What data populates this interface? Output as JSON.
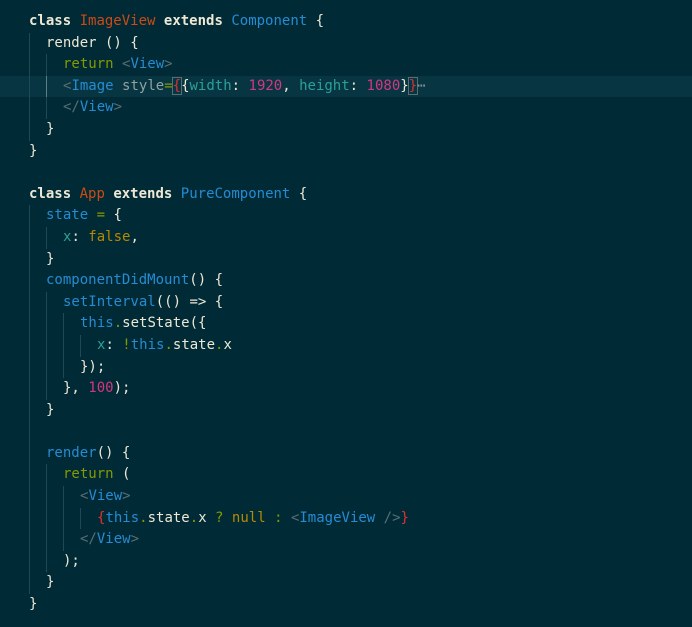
{
  "editor": {
    "theme": "solarized-dark",
    "background": "#002b36",
    "current_line_background": "#073642",
    "fold_icon": "chevron-right-icon",
    "folded_placeholder": "⋯"
  },
  "code": {
    "l1": {
      "kw_class": "class",
      "name": "ImageView",
      "kw_extends": "extends",
      "base": "Component",
      "open": " {"
    },
    "l2": {
      "method": "render",
      "rest": " () {"
    },
    "l3": {
      "kw_return": "return",
      "tag_open": "<",
      "tag": "View",
      "tag_close": ">"
    },
    "l4": {
      "tag_open": "<",
      "tag": "Image",
      "attr": "style",
      "eq": "=",
      "lbrace": "{",
      "obj_open": "{",
      "k1": "width",
      "c1": ": ",
      "v1": "1920",
      "sep": ", ",
      "k2": "height",
      "c2": ": ",
      "v2": "1080",
      "obj_close": "}",
      "rbrace": "}"
    },
    "l5": {
      "tag_open": "</",
      "tag": "View",
      "tag_close": ">"
    },
    "l6": {
      "text": "}"
    },
    "l7": {
      "text": "}"
    },
    "l9": {
      "kw_class": "class",
      "name": "App",
      "kw_extends": "extends",
      "base": "PureComponent",
      "open": " {"
    },
    "l10": {
      "name": "state",
      "eq": " =",
      "open": " {"
    },
    "l11": {
      "key": "x",
      "colon": ": ",
      "value": "false",
      "comma": ","
    },
    "l12": {
      "text": "}"
    },
    "l13": {
      "name": "componentDidMount",
      "rest": "() {"
    },
    "l14": {
      "fn": "setInterval",
      "rest": "(() ",
      "arrow": "=>",
      "open": " {"
    },
    "l15": {
      "kw_this": "this",
      "dot": ".",
      "method": "setState",
      "rest": "({"
    },
    "l16": {
      "key": "x",
      "colon": ": ",
      "bang": "!",
      "kw_this": "this",
      "dot1": ".",
      "p1": "state",
      "dot2": ".",
      "p2": "x"
    },
    "l17": {
      "text": "});"
    },
    "l18": {
      "pre": "}, ",
      "num": "100",
      "post": ");"
    },
    "l19": {
      "text": "}"
    },
    "l21": {
      "name": "render",
      "rest": "() {"
    },
    "l22": {
      "kw_return": "return",
      "rest": " ("
    },
    "l23": {
      "tag_open": "<",
      "tag": "View",
      "tag_close": ">"
    },
    "l24": {
      "lbrace": "{",
      "kw_this": "this",
      "dot1": ".",
      "p1": "state",
      "dot2": ".",
      "p2": "x",
      "q": " ? ",
      "null": "null",
      "colon": " : ",
      "tag_open": "<",
      "tag": "ImageView",
      "tag_close": " />",
      "rbrace": "}"
    },
    "l25": {
      "tag_open": "</",
      "tag": "View",
      "tag_close": ">"
    },
    "l26": {
      "text": ");"
    },
    "l27": {
      "text": "}"
    },
    "l28": {
      "text": "}"
    }
  }
}
